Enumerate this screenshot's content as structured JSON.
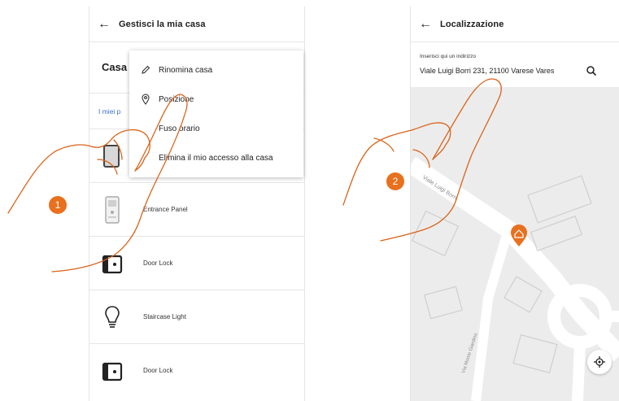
{
  "left_screen": {
    "title": "Gestisci la mia casa",
    "house_label": "Casa",
    "section_link": "I miei p",
    "menu": [
      {
        "label": "Rinomina casa",
        "icon": "pencil-icon"
      },
      {
        "label": "Posizione",
        "icon": "location-pin-icon"
      },
      {
        "label": "Fuso orario",
        "icon": ""
      },
      {
        "label": "Elimina il mio accesso alla casa",
        "icon": ""
      }
    ],
    "devices": [
      {
        "label": "Entrance Panel",
        "icon": "entrance-panel-icon"
      },
      {
        "label": "Door Lock",
        "icon": "door-lock-icon"
      },
      {
        "label": "Staircase Light",
        "icon": "light-bulb-icon"
      },
      {
        "label": "Door Lock",
        "icon": "door-lock-icon"
      }
    ]
  },
  "right_screen": {
    "title": "Localizzazione",
    "address_label": "Inserisci qui un indirizzo",
    "address_value": "Viale Luigi Borri 231, 21100 Varese Vares",
    "map_labels": [
      "Viale Luigi Borri",
      "Via Monte Giardino"
    ]
  },
  "steps": [
    "1",
    "2"
  ],
  "colors": {
    "accent": "#e8701e",
    "link": "#3b6fc9",
    "map_bg": "#ececec"
  }
}
